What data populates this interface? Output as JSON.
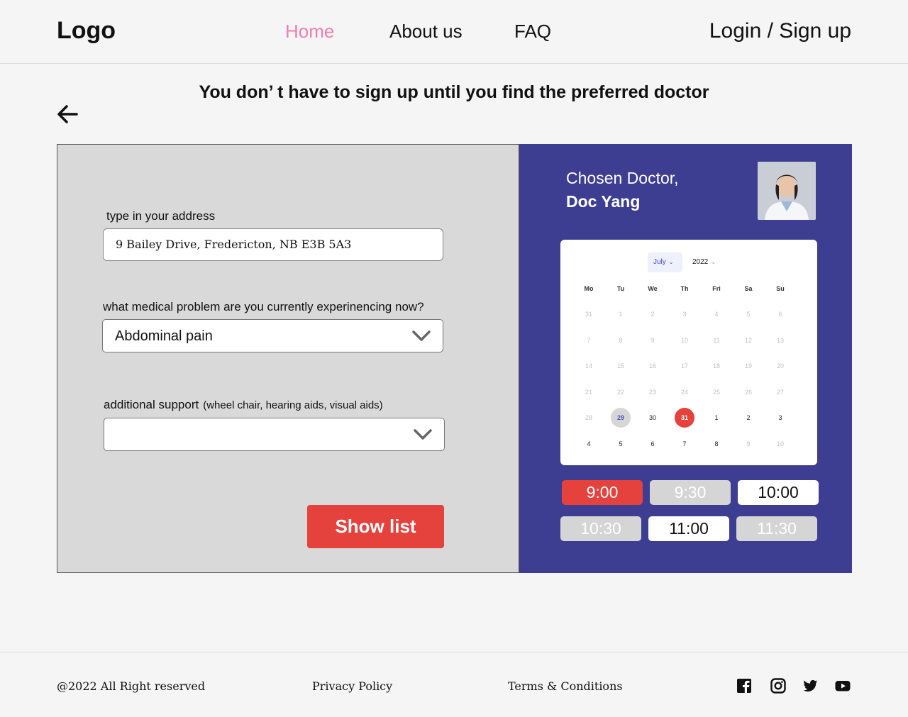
{
  "header": {
    "logo": "Logo",
    "nav": {
      "home": "Home",
      "about": "About us",
      "faq": "FAQ"
    },
    "login": "Login / Sign up"
  },
  "headline": "You don’ t have to sign up until you find the preferred doctor",
  "form": {
    "address_label": "type in your address",
    "address_value": "9 Bailey Drive, Fredericton, NB E3B 5A3",
    "problem_label": "what medical problem are you currently experinencing now?",
    "problem_value": "Abdominal pain",
    "support_label": "additional support",
    "support_sublabel": "(wheel chair, hearing aids, visual aids)",
    "support_value": "",
    "submit_label": "Show list"
  },
  "doctor": {
    "caption": "Chosen Doctor,",
    "name": "Doc Yang"
  },
  "calendar": {
    "month": "July",
    "year": "2022",
    "weekdays": [
      "Mo",
      "Tu",
      "We",
      "Th",
      "Fri",
      "Sa",
      "Su"
    ],
    "weeks": [
      [
        {
          "d": "31",
          "s": "muted"
        },
        {
          "d": "1",
          "s": "muted"
        },
        {
          "d": "2",
          "s": "muted"
        },
        {
          "d": "3",
          "s": "muted"
        },
        {
          "d": "4",
          "s": "muted"
        },
        {
          "d": "5",
          "s": "muted"
        },
        {
          "d": "6",
          "s": "muted"
        }
      ],
      [
        {
          "d": "7",
          "s": "muted"
        },
        {
          "d": "8",
          "s": "muted"
        },
        {
          "d": "9",
          "s": "muted"
        },
        {
          "d": "10",
          "s": "muted"
        },
        {
          "d": "11",
          "s": "muted"
        },
        {
          "d": "12",
          "s": "muted"
        },
        {
          "d": "13",
          "s": "muted"
        }
      ],
      [
        {
          "d": "14",
          "s": "muted"
        },
        {
          "d": "15",
          "s": "muted"
        },
        {
          "d": "16",
          "s": "muted"
        },
        {
          "d": "17",
          "s": "muted"
        },
        {
          "d": "18",
          "s": "muted"
        },
        {
          "d": "19",
          "s": "muted"
        },
        {
          "d": "20",
          "s": "muted"
        }
      ],
      [
        {
          "d": "21",
          "s": "muted"
        },
        {
          "d": "22",
          "s": "muted"
        },
        {
          "d": "23",
          "s": "muted"
        },
        {
          "d": "24",
          "s": "muted"
        },
        {
          "d": "25",
          "s": "muted"
        },
        {
          "d": "26",
          "s": "muted"
        },
        {
          "d": "27",
          "s": "muted"
        }
      ],
      [
        {
          "d": "28",
          "s": "muted"
        },
        {
          "d": "29",
          "s": "hover"
        },
        {
          "d": "30",
          "s": "normal"
        },
        {
          "d": "31",
          "s": "selected"
        },
        {
          "d": "1",
          "s": "normal"
        },
        {
          "d": "2",
          "s": "normal"
        },
        {
          "d": "3",
          "s": "normal"
        }
      ],
      [
        {
          "d": "4",
          "s": "normal"
        },
        {
          "d": "5",
          "s": "normal"
        },
        {
          "d": "6",
          "s": "normal"
        },
        {
          "d": "7",
          "s": "normal"
        },
        {
          "d": "8",
          "s": "normal"
        },
        {
          "d": "9",
          "s": "muted"
        },
        {
          "d": "10",
          "s": "muted"
        }
      ]
    ]
  },
  "time_slots": [
    [
      {
        "t": "9:00",
        "s": "active"
      },
      {
        "t": "9:30",
        "s": "unavail"
      },
      {
        "t": "10:00",
        "s": "avail"
      }
    ],
    [
      {
        "t": "10:30",
        "s": "unavail"
      },
      {
        "t": "11:00",
        "s": "avail"
      },
      {
        "t": "11:30",
        "s": "unavail"
      }
    ]
  ],
  "footer": {
    "copyright": "@2022 All Right reserved",
    "privacy": "Privacy Policy",
    "terms": "Terms & Conditions",
    "social_icons": [
      "facebook-icon",
      "instagram-icon",
      "twitter-icon",
      "youtube-icon"
    ]
  },
  "colors": {
    "accent_red": "#e5413d",
    "panel_blue": "#3d3d91",
    "nav_active_pink": "#ee7fb4"
  }
}
